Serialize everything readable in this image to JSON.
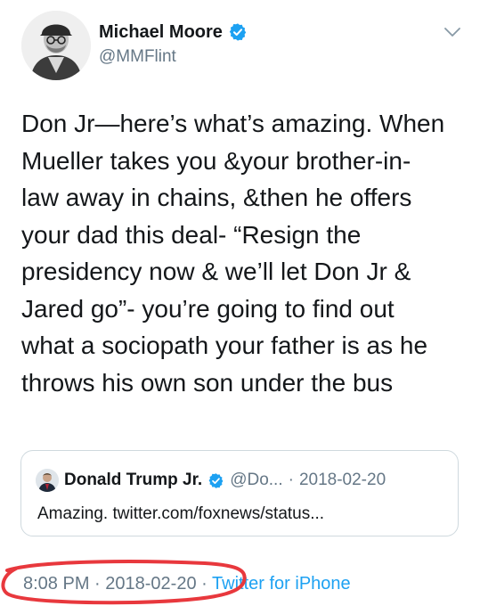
{
  "tweet": {
    "author": {
      "display_name": "Michael Moore",
      "handle": "@MMFlint",
      "verified": true
    },
    "text_lines": [
      "Don Jr—here’s what’s amazing. When",
      "Mueller takes you &your brother-in-",
      "law away in chains, &then he offers",
      "your dad this deal- “Resign the",
      "presidency now & we’ll let Don Jr &",
      "Jared go”- you’re going to find out",
      "what a sociopath your father is as he",
      "throws his own son under the bus"
    ],
    "quoted": {
      "display_name": "Donald Trump Jr.",
      "handle": "@Do...",
      "separator": "·",
      "date": "2018-02-20",
      "text": "Amazing. twitter.com/foxnews/status..."
    },
    "meta": {
      "time": "8:08 PM",
      "separator": "·",
      "date": "2018-02-20",
      "source": "Twitter for iPhone"
    }
  },
  "colors": {
    "text": "#14171a",
    "secondary": "#657786",
    "accent": "#1da1f2",
    "verified": "#1da1f2",
    "border": "#cfd9de",
    "annotation_red": "#e8383d"
  },
  "icons": {
    "verified": "verified-badge-icon",
    "menu": "chevron-down-icon"
  }
}
